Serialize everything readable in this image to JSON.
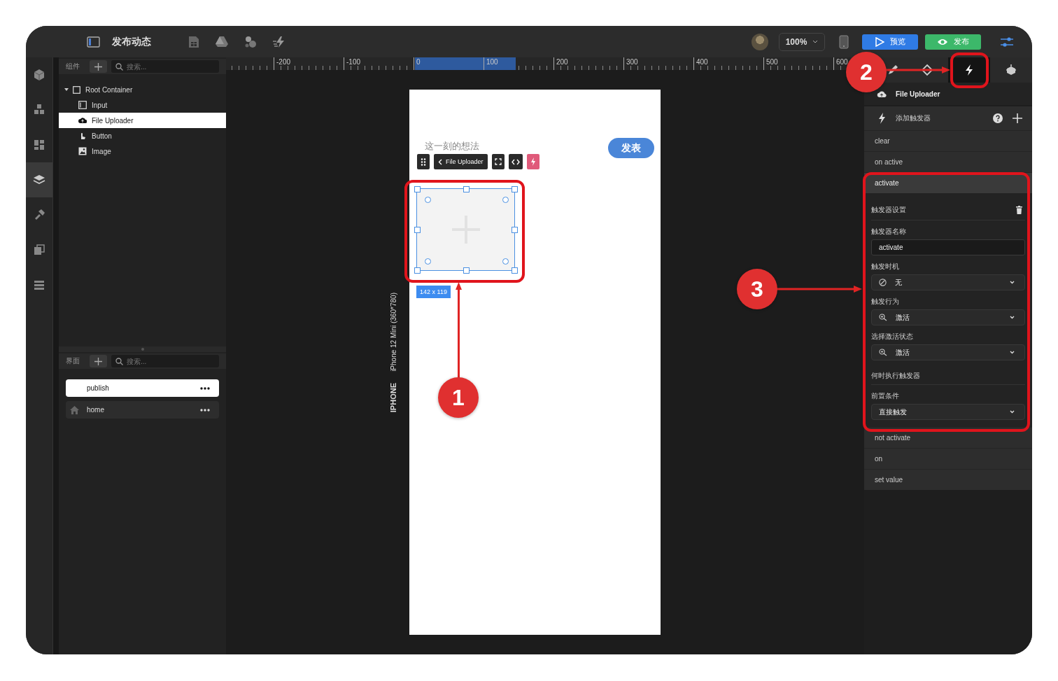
{
  "window": {
    "title": "发布动态"
  },
  "topbar": {
    "zoom": "100%",
    "actions": [
      {
        "label": "预览",
        "kind": "preview"
      },
      {
        "label": "发布",
        "kind": "publish"
      }
    ]
  },
  "rail": [
    {
      "selected": false
    },
    {
      "selected": false
    },
    {
      "selected": false
    },
    {
      "selected": true
    },
    {
      "selected": false
    },
    {
      "selected": false
    },
    {
      "selected": false
    }
  ],
  "components": {
    "label": "组件",
    "search_placeholder": "搜索...",
    "tree": [
      {
        "label": "Root Container",
        "kind": "container",
        "expanded": true,
        "selected": false,
        "children": [
          {
            "label": "Input",
            "kind": "input",
            "selected": false
          },
          {
            "label": "File Uploader",
            "kind": "uploader",
            "selected": true
          },
          {
            "label": "Button",
            "kind": "button",
            "selected": false
          },
          {
            "label": "Image",
            "kind": "image",
            "selected": false
          }
        ]
      }
    ]
  },
  "pages": {
    "label": "界面",
    "search_placeholder": "搜索...",
    "items": [
      {
        "label": "publish",
        "selected": true,
        "home": false
      },
      {
        "label": "home",
        "selected": false,
        "home": true
      }
    ]
  },
  "ruler": {
    "ticks": [
      "-200",
      "-100",
      "0",
      "100",
      "200",
      "300",
      "400",
      "500",
      "600"
    ]
  },
  "canvas": {
    "device_model": "iPhone 12 Mini (360*780)",
    "device_type": "IPHONE",
    "phone": {
      "placeholder": "这一刻的想法",
      "submit": "发表",
      "selection": {
        "label": "File Uploader",
        "size": "142 x 119"
      }
    }
  },
  "right_panel": {
    "tabs": [
      {
        "selected": false
      },
      {
        "selected": false
      },
      {
        "selected": true
      },
      {
        "selected": false
      }
    ],
    "component": "File Uploader",
    "add_trigger": "添加触发器",
    "triggers": [
      {
        "label": "clear",
        "expanded": false
      },
      {
        "label": "on active",
        "expanded": false
      },
      {
        "label": "activate",
        "expanded": true,
        "settings": {
          "title": "触发器设置",
          "name_label": "触发器名称",
          "name_value": "activate",
          "fields": [
            {
              "label": "触发时机",
              "value": "无",
              "kind": "none"
            },
            {
              "label": "触发行为",
              "value": "激活",
              "kind": "activate"
            },
            {
              "label": "选择激活状态",
              "value": "激活",
              "kind": "activate"
            }
          ],
          "when_title": "何时执行触发器",
          "condition": {
            "label": "前置条件",
            "value": "直接触发"
          }
        }
      },
      {
        "label": "not activate",
        "expanded": false
      },
      {
        "label": "on",
        "expanded": false
      },
      {
        "label": "set value",
        "expanded": false
      }
    ]
  },
  "annotations": [
    {
      "number": "1"
    },
    {
      "number": "2"
    },
    {
      "number": "3"
    }
  ]
}
